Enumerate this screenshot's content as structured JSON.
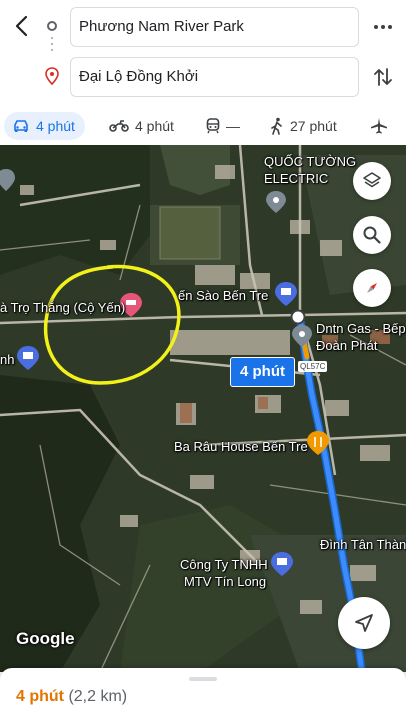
{
  "route": {
    "origin": "Phương Nam River Park",
    "destination": "Đại Lộ Đồng Khởi"
  },
  "modes": [
    {
      "name": "car",
      "label": "4 phút",
      "active": true
    },
    {
      "name": "motorbike",
      "label": "4 phút",
      "active": false
    },
    {
      "name": "transit",
      "label": "—",
      "active": false
    },
    {
      "name": "walk",
      "label": "27 phút",
      "active": false
    },
    {
      "name": "flight",
      "label": "",
      "active": false
    }
  ],
  "map": {
    "labels": {
      "quoc_tuong_line1": "QUỐC TƯỜNG",
      "quoc_tuong_line2": "ELECTRIC",
      "nha_tro": "à Trọ Thắng (Cộ Yến)",
      "yen_sao": "ến Sào Bến Tre",
      "gas_line1": "Dntn Gas - Bếp",
      "gas_line2": "Đoàn Phát",
      "left_cut": "nh",
      "ba_rau": "Ba Râu House Bến Tre",
      "dinh": "Đình Tân Thành",
      "tin_long_line1": "Công Ty TNHH",
      "tin_long_line2": "MTV Tín Long"
    },
    "route_badge": "4 phút",
    "road_tag": "QL57C",
    "attribution": "Google",
    "route_color": "#1a73e8",
    "highlight_color": "#f2f21a"
  },
  "summary": {
    "duration": "4 phút",
    "distance": "(2,2 km)"
  },
  "icons": [
    "back-arrow-icon",
    "origin-circle-icon",
    "destination-pin-icon",
    "more-icon",
    "swap-icon",
    "car-icon",
    "motorbike-icon",
    "transit-icon",
    "walk-icon",
    "flight-icon",
    "layers-icon",
    "search-icon",
    "compass-icon",
    "my-location-icon"
  ]
}
